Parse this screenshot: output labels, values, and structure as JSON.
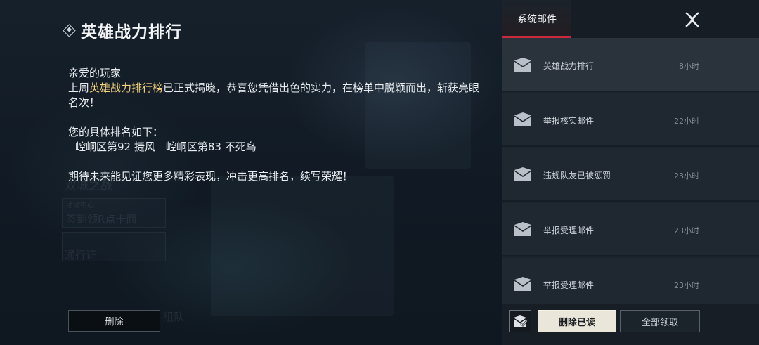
{
  "mail": {
    "title": "英雄战力排行",
    "greeting": "亲爱的玩家",
    "line1_prefix": "上周",
    "line1_highlight": "英雄战力排行榜",
    "line1_suffix": "已正式揭晓，恭喜您凭借出色的实力，在榜单中脱颖而出，斩获亮眼名次！",
    "ranking_intro": "您的具体排名如下：",
    "ranking_line": "崆峒区第92 捷风　崆峒区第83 不死鸟",
    "closing": "期待未来能见证您更多精彩表现，冲击更高排名，续写荣耀！",
    "delete_label": "删除"
  },
  "background_ghost": {
    "city_battle": "双城之战",
    "activity_center": "活动中心",
    "sign_in": "签到领R点卡面",
    "pass": "通行证",
    "team": "组队"
  },
  "panel": {
    "tab_label": "系统邮件",
    "close_icon": "close-x-icon",
    "items": [
      {
        "subject": "英雄战力排行",
        "time": "8小时",
        "selected": true
      },
      {
        "subject": "举报核实邮件",
        "time": "22小时",
        "selected": false
      },
      {
        "subject": "违规队友已被惩罚",
        "time": "23小时",
        "selected": false
      },
      {
        "subject": "举报受理邮件",
        "time": "23小时",
        "selected": false
      },
      {
        "subject": "举报受理邮件",
        "time": "23小时",
        "selected": false
      }
    ],
    "footer": {
      "icon": "mail-check-icon",
      "delete_read_label": "删除已读",
      "claim_all_label": "全部领取"
    }
  },
  "colors": {
    "highlight": "#f2d27a",
    "tab_accent": "#c8283a",
    "primary_button": "#ebe6da"
  }
}
